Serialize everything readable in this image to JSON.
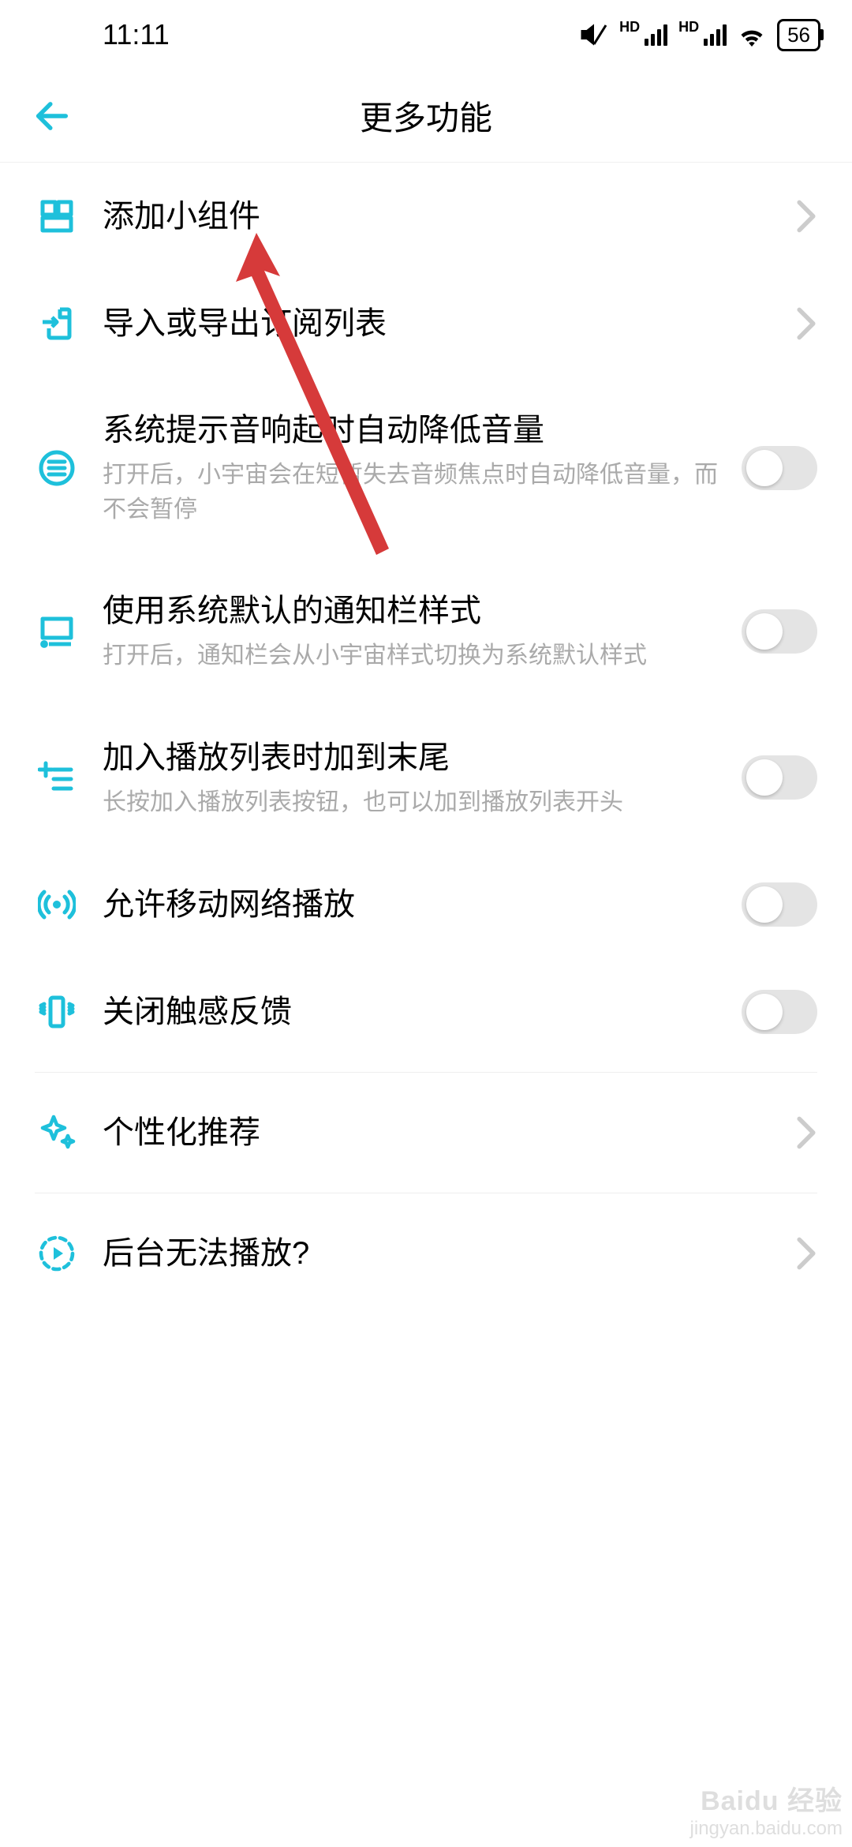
{
  "colors": {
    "accent": "#1EC0DB",
    "arrow": "#D63A3A"
  },
  "status": {
    "time": "11:11",
    "hd_label": "HD",
    "battery": "56"
  },
  "header": {
    "title": "更多功能"
  },
  "items": {
    "add_widget": {
      "title": "添加小组件",
      "type": "nav"
    },
    "import_export": {
      "title": "导入或导出订阅列表",
      "type": "nav"
    },
    "lower_volume": {
      "title": "系统提示音响起时自动降低音量",
      "desc": "打开后，小宇宙会在短暂失去音频焦点时自动降低音量，而不会暂停",
      "type": "toggle",
      "on": false
    },
    "notif_style": {
      "title": "使用系统默认的通知栏样式",
      "desc": "打开后，通知栏会从小宇宙样式切换为系统默认样式",
      "type": "toggle",
      "on": false
    },
    "add_to_end": {
      "title": "加入播放列表时加到末尾",
      "desc": "长按加入播放列表按钮，也可以加到播放列表开头",
      "type": "toggle",
      "on": false
    },
    "cellular_play": {
      "title": "允许移动网络播放",
      "type": "toggle",
      "on": false
    },
    "haptic_off": {
      "title": "关闭触感反馈",
      "type": "toggle",
      "on": false
    },
    "personalized": {
      "title": "个性化推荐",
      "type": "nav"
    },
    "bg_play_help": {
      "title": "后台无法播放?",
      "type": "nav"
    }
  },
  "watermark": {
    "brand": "Baidu 经验",
    "url": "jingyan.baidu.com"
  }
}
